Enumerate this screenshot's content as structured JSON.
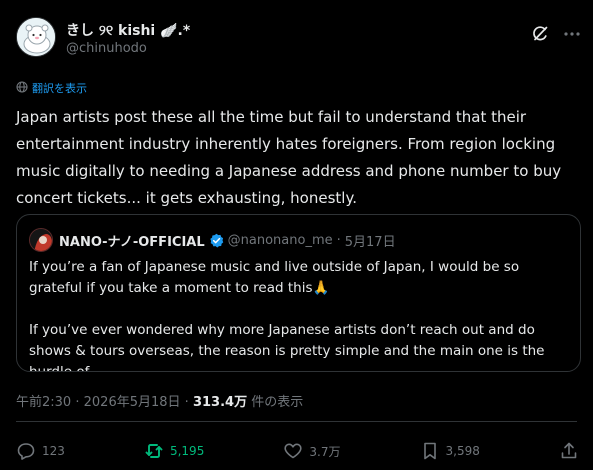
{
  "author": {
    "display_name": "きし ୨୧ kishi 🪽.*",
    "handle": "@chinuhodo"
  },
  "translate_label": "翻訳を表示",
  "tweet_text": "Japan artists post these all the time but fail to understand that their entertainment industry inherently hates foreigners. From region locking music digitally to needing a Japanese address and phone number to buy concert tickets... it gets exhausting, honestly.",
  "quote": {
    "name": "NANO-ナノ-OFFICIAL",
    "handle": "@nanonano_me",
    "sep": "·",
    "date": "5月17日",
    "para1": "If you’re a fan of Japanese music and live outside of Japan, I would be so grateful if you take a moment to read this🙏",
    "para2": "If you’ve ever wondered why more Japanese artists don’t reach out and do shows & tours overseas, the reason is pretty simple and the main one is the hurdle of"
  },
  "meta": {
    "time": "午前2:30",
    "sep": "·",
    "date": "2026年5月18日",
    "sep2": "·",
    "views": "313.4万",
    "views_label": "件の表示"
  },
  "actions": {
    "replies": "123",
    "retweets": "5,195",
    "likes": "3.7万",
    "bookmarks": "3,598"
  },
  "colors": {
    "accent": "#1d9bf0",
    "retweet_active": "#00ba7c",
    "muted": "#71767b"
  },
  "icons": [
    "grok-icon",
    "more-icon",
    "translate-icon",
    "verified-icon",
    "reply-icon",
    "retweet-icon",
    "like-icon",
    "bookmark-icon",
    "share-icon"
  ]
}
